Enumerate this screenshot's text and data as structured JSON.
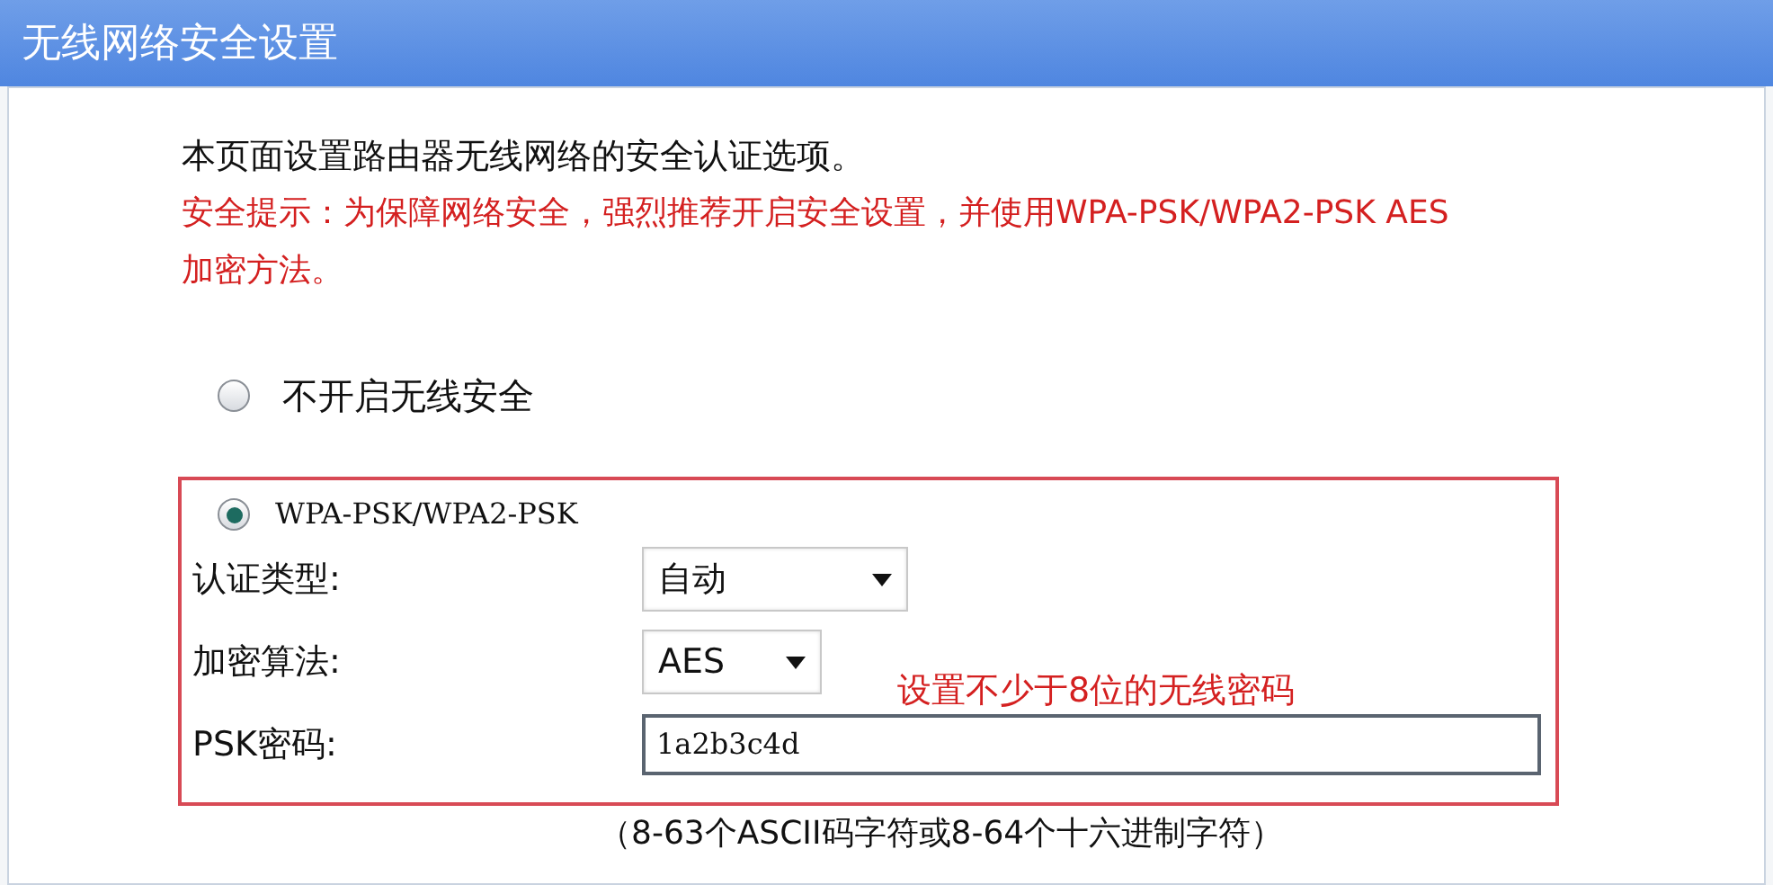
{
  "window": {
    "title": "无线网络安全设置"
  },
  "description": "本页面设置路由器无线网络的安全认证选项。",
  "security_tip": "安全提示：为保障网络安全，强烈推荐开启安全设置，并使用WPA-PSK/WPA2-PSK AES加密方法。",
  "security_options": [
    {
      "kind": "off",
      "label": "不开启无线安全",
      "selected": false
    },
    {
      "kind": "wpa",
      "label": "WPA-PSK/WPA2-PSK",
      "selected": true,
      "fields": [
        {
          "kind": "select",
          "label": "认证类型:",
          "value": "自动"
        },
        {
          "kind": "select",
          "label": "加密算法:",
          "value": "AES"
        },
        {
          "kind": "password",
          "label": "PSK密码:",
          "value": "1a2b3c4d"
        }
      ]
    }
  ],
  "annotation": "设置不少于8位的无线密码",
  "psk_hint": "（8-63个ASCII码字符或8-64个十六进制字符）"
}
